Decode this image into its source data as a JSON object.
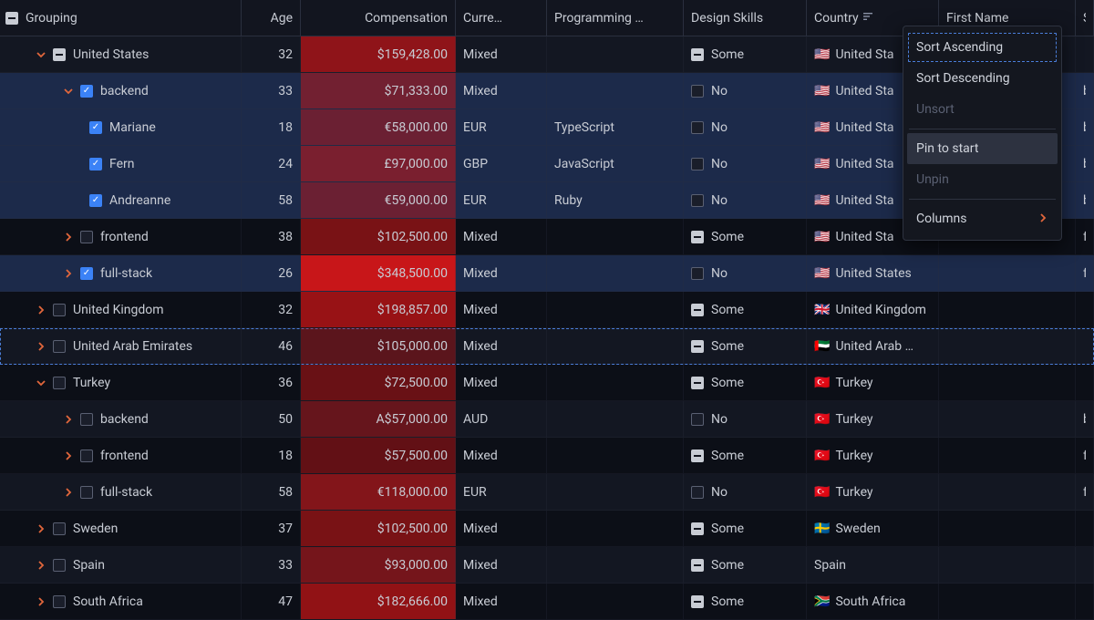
{
  "columns": {
    "grouping": "Grouping",
    "age": "Age",
    "compensation": "Compensation",
    "currency": "Curre…",
    "programming": "Programming …",
    "design": "Design Skills",
    "country": "Country",
    "firstname": "First Name",
    "extra": "S"
  },
  "context_menu": {
    "sort_asc": "Sort Ascending",
    "sort_desc": "Sort Descending",
    "unsort": "Unsort",
    "pin_start": "Pin to start",
    "unpin": "Unpin",
    "columns": "Columns"
  },
  "rows": [
    {
      "indent": 1,
      "expand": "down",
      "check": "indet",
      "label": "United States",
      "age": "32",
      "comp": "$159,428.00",
      "comp_tone": 0.55,
      "curr": "Mixed",
      "prog": "",
      "design_check": "indet",
      "design": "Some",
      "flag": "🇺🇸",
      "country": "United Sta",
      "firstname": "",
      "extra": "",
      "stripe": "light",
      "selected": false,
      "focused": false
    },
    {
      "indent": 2,
      "expand": "down",
      "check": "checked",
      "label": "backend",
      "age": "33",
      "comp": "$71,333.00",
      "comp_tone": 0.35,
      "curr": "Mixed",
      "prog": "",
      "design_check": "empty",
      "design": "No",
      "flag": "🇺🇸",
      "country": "United Sta",
      "firstname": "",
      "extra": "b",
      "stripe": "dark",
      "selected": true,
      "focused": false
    },
    {
      "indent": "leaf",
      "expand": "none",
      "check": "checked",
      "label": "Mariane",
      "age": "18",
      "comp": "€58,000.00",
      "comp_tone": 0.3,
      "curr": "EUR",
      "prog": "TypeScript",
      "design_check": "empty",
      "design": "No",
      "flag": "🇺🇸",
      "country": "United Sta",
      "firstname": "",
      "extra": "b",
      "stripe": "light",
      "selected": true,
      "focused": false
    },
    {
      "indent": "leaf",
      "expand": "none",
      "check": "checked",
      "label": "Fern",
      "age": "24",
      "comp": "£97,000.00",
      "comp_tone": 0.4,
      "curr": "GBP",
      "prog": "JavaScript",
      "design_check": "empty",
      "design": "No",
      "flag": "🇺🇸",
      "country": "United Sta",
      "firstname": "",
      "extra": "b",
      "stripe": "dark",
      "selected": true,
      "focused": false
    },
    {
      "indent": "leaf",
      "expand": "none",
      "check": "checked",
      "label": "Andreanne",
      "age": "58",
      "comp": "€59,000.00",
      "comp_tone": 0.3,
      "curr": "EUR",
      "prog": "Ruby",
      "design_check": "empty",
      "design": "No",
      "flag": "🇺🇸",
      "country": "United Sta",
      "firstname": "",
      "extra": "b",
      "stripe": "light",
      "selected": true,
      "focused": false
    },
    {
      "indent": 2,
      "expand": "right",
      "check": "empty",
      "label": "frontend",
      "age": "38",
      "comp": "$102,500.00",
      "comp_tone": 0.45,
      "curr": "Mixed",
      "prog": "",
      "design_check": "indet",
      "design": "Some",
      "flag": "🇺🇸",
      "country": "United Sta",
      "firstname": "",
      "extra": "f",
      "stripe": "dark",
      "selected": false,
      "focused": false
    },
    {
      "indent": 2,
      "expand": "right",
      "check": "checked",
      "label": "full-stack",
      "age": "26",
      "comp": "$348,500.00",
      "comp_tone": 1.0,
      "curr": "Mixed",
      "prog": "",
      "design_check": "empty",
      "design": "No",
      "flag": "🇺🇸",
      "country": "United States",
      "firstname": "",
      "extra": "f",
      "stripe": "light",
      "selected": true,
      "focused": false
    },
    {
      "indent": 1,
      "expand": "right",
      "check": "empty",
      "label": "United Kingdom",
      "age": "32",
      "comp": "$198,857.00",
      "comp_tone": 0.62,
      "curr": "Mixed",
      "prog": "",
      "design_check": "indet",
      "design": "Some",
      "flag": "🇬🇧",
      "country": "United Kingdom",
      "firstname": "",
      "extra": "",
      "stripe": "dark",
      "selected": false,
      "focused": false
    },
    {
      "indent": 1,
      "expand": "right",
      "check": "empty",
      "label": "United Arab Emirates",
      "age": "46",
      "comp": "$105,000.00",
      "comp_tone": 0.25,
      "curr": "Mixed",
      "prog": "",
      "design_check": "indet",
      "design": "Some",
      "flag": "🇦🇪",
      "country": "United Arab …",
      "firstname": "",
      "extra": "",
      "stripe": "light",
      "selected": false,
      "focused": true
    },
    {
      "indent": 1,
      "expand": "down",
      "check": "empty",
      "label": "Turkey",
      "age": "36",
      "comp": "$72,500.00",
      "comp_tone": 0.35,
      "curr": "Mixed",
      "prog": "",
      "design_check": "indet",
      "design": "Some",
      "flag": "🇹🇷",
      "country": "Turkey",
      "firstname": "",
      "extra": "",
      "stripe": "dark",
      "selected": false,
      "focused": false
    },
    {
      "indent": 2,
      "expand": "right",
      "check": "empty",
      "label": "backend",
      "age": "50",
      "comp": "A$57,000.00",
      "comp_tone": 0.3,
      "curr": "AUD",
      "prog": "",
      "design_check": "empty",
      "design": "No",
      "flag": "🇹🇷",
      "country": "Turkey",
      "firstname": "",
      "extra": "b",
      "stripe": "light",
      "selected": false,
      "focused": false
    },
    {
      "indent": 2,
      "expand": "right",
      "check": "empty",
      "label": "frontend",
      "age": "18",
      "comp": "$57,500.00",
      "comp_tone": 0.3,
      "curr": "Mixed",
      "prog": "",
      "design_check": "indet",
      "design": "Some",
      "flag": "🇹🇷",
      "country": "Turkey",
      "firstname": "",
      "extra": "f",
      "stripe": "dark",
      "selected": false,
      "focused": false
    },
    {
      "indent": 2,
      "expand": "right",
      "check": "empty",
      "label": "full-stack",
      "age": "58",
      "comp": "€118,000.00",
      "comp_tone": 0.48,
      "curr": "EUR",
      "prog": "",
      "design_check": "empty",
      "design": "No",
      "flag": "🇹🇷",
      "country": "Turkey",
      "firstname": "",
      "extra": "f",
      "stripe": "light",
      "selected": false,
      "focused": false
    },
    {
      "indent": 1,
      "expand": "right",
      "check": "empty",
      "label": "Sweden",
      "age": "37",
      "comp": "$102,500.00",
      "comp_tone": 0.45,
      "curr": "Mixed",
      "prog": "",
      "design_check": "indet",
      "design": "Some",
      "flag": "🇸🇪",
      "country": "Sweden",
      "firstname": "",
      "extra": "",
      "stripe": "dark",
      "selected": false,
      "focused": false
    },
    {
      "indent": 1,
      "expand": "right",
      "check": "empty",
      "label": "Spain",
      "age": "33",
      "comp": "$93,000.00",
      "comp_tone": 0.4,
      "curr": "Mixed",
      "prog": "",
      "design_check": "indet",
      "design": "Some",
      "flag": "",
      "country": "Spain",
      "firstname": "",
      "extra": "",
      "stripe": "light",
      "selected": false,
      "focused": false
    },
    {
      "indent": 1,
      "expand": "right",
      "check": "empty",
      "label": "South Africa",
      "age": "47",
      "comp": "$182,666.00",
      "comp_tone": 0.58,
      "curr": "Mixed",
      "prog": "",
      "design_check": "indet",
      "design": "Some",
      "flag": "🇿🇦",
      "country": "South Africa",
      "firstname": "",
      "extra": "",
      "stripe": "dark",
      "selected": false,
      "focused": false
    }
  ]
}
